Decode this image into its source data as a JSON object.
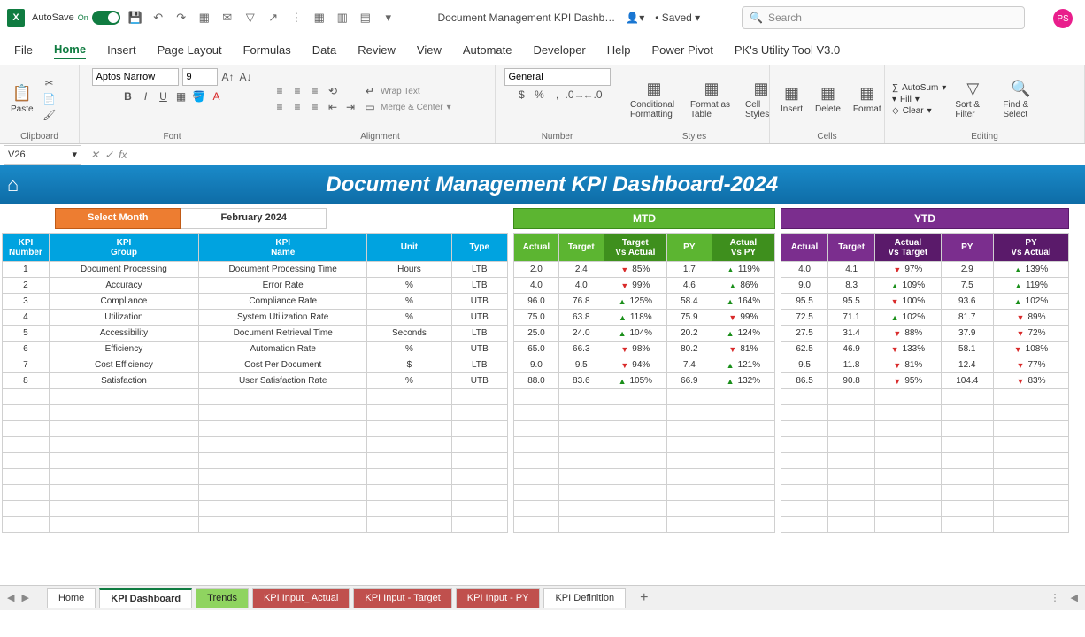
{
  "titlebar": {
    "autosave_label": "AutoSave",
    "autosave_on": "On",
    "doc_title": "Document Management KPI Dashb…",
    "save_status": "Saved",
    "search_placeholder": "Search",
    "avatar_initials": "PS"
  },
  "menu": {
    "tabs": [
      "File",
      "Home",
      "Insert",
      "Page Layout",
      "Formulas",
      "Data",
      "Review",
      "View",
      "Automate",
      "Developer",
      "Help",
      "Power Pivot",
      "PK's Utility Tool V3.0"
    ],
    "active_index": 1
  },
  "ribbon": {
    "clipboard": {
      "paste": "Paste",
      "label": "Clipboard"
    },
    "font": {
      "name": "Aptos Narrow",
      "size": "9",
      "label": "Font"
    },
    "alignment": {
      "wrap": "Wrap Text",
      "merge": "Merge & Center",
      "label": "Alignment"
    },
    "number": {
      "format": "General",
      "label": "Number"
    },
    "styles": {
      "cond": "Conditional Formatting",
      "table": "Format as Table",
      "cell": "Cell Styles",
      "label": "Styles"
    },
    "cells": {
      "insert": "Insert",
      "delete": "Delete",
      "format": "Format",
      "label": "Cells"
    },
    "editing": {
      "autosum": "AutoSum",
      "fill": "Fill",
      "clear": "Clear",
      "sort": "Sort & Filter",
      "find": "Find & Select",
      "label": "Editing"
    }
  },
  "namebox": "V26",
  "dashboard": {
    "title": "Document Management KPI Dashboard-2024",
    "select_month_label": "Select Month",
    "month_value": "February 2024",
    "mtd_label": "MTD",
    "ytd_label": "YTD",
    "info_headers": [
      "KPI Number",
      "KPI Group",
      "KPI Name",
      "Unit",
      "Type"
    ],
    "mtd_headers": [
      "Actual",
      "Target",
      "Target Vs Actual",
      "PY",
      "Actual Vs PY"
    ],
    "ytd_headers": [
      "Actual",
      "Target",
      "Actual Vs Target",
      "PY",
      "PY Vs Actual"
    ],
    "rows": [
      {
        "num": "1",
        "group": "Document Processing",
        "name": "Document Processing Time",
        "unit": "Hours",
        "type": "LTB",
        "mtd": {
          "actual": "2.0",
          "target": "2.4",
          "tva_dir": "down",
          "tva": "85%",
          "py": "1.7",
          "avpy_dir": "up",
          "avpy": "119%"
        },
        "ytd": {
          "actual": "4.0",
          "target": "4.1",
          "avt_dir": "down",
          "avt": "97%",
          "py": "2.9",
          "pva_dir": "up",
          "pva": "139%"
        }
      },
      {
        "num": "2",
        "group": "Accuracy",
        "name": "Error Rate",
        "unit": "%",
        "type": "LTB",
        "mtd": {
          "actual": "4.0",
          "target": "4.0",
          "tva_dir": "down",
          "tva": "99%",
          "py": "4.6",
          "avpy_dir": "up",
          "avpy": "86%"
        },
        "ytd": {
          "actual": "9.0",
          "target": "8.3",
          "avt_dir": "up",
          "avt": "109%",
          "py": "7.5",
          "pva_dir": "up",
          "pva": "119%"
        }
      },
      {
        "num": "3",
        "group": "Compliance",
        "name": "Compliance Rate",
        "unit": "%",
        "type": "UTB",
        "mtd": {
          "actual": "96.0",
          "target": "76.8",
          "tva_dir": "up",
          "tva": "125%",
          "py": "58.4",
          "avpy_dir": "up",
          "avpy": "164%"
        },
        "ytd": {
          "actual": "95.5",
          "target": "95.5",
          "avt_dir": "down",
          "avt": "100%",
          "py": "93.6",
          "pva_dir": "up",
          "pva": "102%"
        }
      },
      {
        "num": "4",
        "group": "Utilization",
        "name": "System Utilization Rate",
        "unit": "%",
        "type": "UTB",
        "mtd": {
          "actual": "75.0",
          "target": "63.8",
          "tva_dir": "up",
          "tva": "118%",
          "py": "75.9",
          "avpy_dir": "down",
          "avpy": "99%"
        },
        "ytd": {
          "actual": "72.5",
          "target": "71.1",
          "avt_dir": "up",
          "avt": "102%",
          "py": "81.7",
          "pva_dir": "down",
          "pva": "89%"
        }
      },
      {
        "num": "5",
        "group": "Accessibility",
        "name": "Document Retrieval Time",
        "unit": "Seconds",
        "type": "LTB",
        "mtd": {
          "actual": "25.0",
          "target": "24.0",
          "tva_dir": "up",
          "tva": "104%",
          "py": "20.2",
          "avpy_dir": "up",
          "avpy": "124%"
        },
        "ytd": {
          "actual": "27.5",
          "target": "31.4",
          "avt_dir": "down",
          "avt": "88%",
          "py": "37.9",
          "pva_dir": "down",
          "pva": "72%"
        }
      },
      {
        "num": "6",
        "group": "Efficiency",
        "name": "Automation Rate",
        "unit": "%",
        "type": "UTB",
        "mtd": {
          "actual": "65.0",
          "target": "66.3",
          "tva_dir": "down",
          "tva": "98%",
          "py": "80.2",
          "avpy_dir": "down",
          "avpy": "81%"
        },
        "ytd": {
          "actual": "62.5",
          "target": "46.9",
          "avt_dir": "down",
          "avt": "133%",
          "py": "58.1",
          "pva_dir": "down",
          "pva": "108%"
        }
      },
      {
        "num": "7",
        "group": "Cost Efficiency",
        "name": "Cost Per Document",
        "unit": "$",
        "type": "LTB",
        "mtd": {
          "actual": "9.0",
          "target": "9.5",
          "tva_dir": "down",
          "tva": "94%",
          "py": "7.4",
          "avpy_dir": "up",
          "avpy": "121%"
        },
        "ytd": {
          "actual": "9.5",
          "target": "11.8",
          "avt_dir": "down",
          "avt": "81%",
          "py": "12.4",
          "pva_dir": "down",
          "pva": "77%"
        }
      },
      {
        "num": "8",
        "group": "Satisfaction",
        "name": "User Satisfaction Rate",
        "unit": "%",
        "type": "UTB",
        "mtd": {
          "actual": "88.0",
          "target": "83.6",
          "tva_dir": "up",
          "tva": "105%",
          "py": "66.9",
          "avpy_dir": "up",
          "avpy": "132%"
        },
        "ytd": {
          "actual": "86.5",
          "target": "90.8",
          "avt_dir": "down",
          "avt": "95%",
          "py": "104.4",
          "pva_dir": "down",
          "pva": "83%"
        }
      }
    ]
  },
  "sheets": {
    "tabs": [
      {
        "name": "Home",
        "style": "plain"
      },
      {
        "name": "KPI Dashboard",
        "style": "active"
      },
      {
        "name": "Trends",
        "style": "green"
      },
      {
        "name": "KPI Input_ Actual",
        "style": "brown"
      },
      {
        "name": "KPI Input - Target",
        "style": "brown"
      },
      {
        "name": "KPI Input - PY",
        "style": "brown"
      },
      {
        "name": "KPI Definition",
        "style": "plain"
      }
    ]
  }
}
